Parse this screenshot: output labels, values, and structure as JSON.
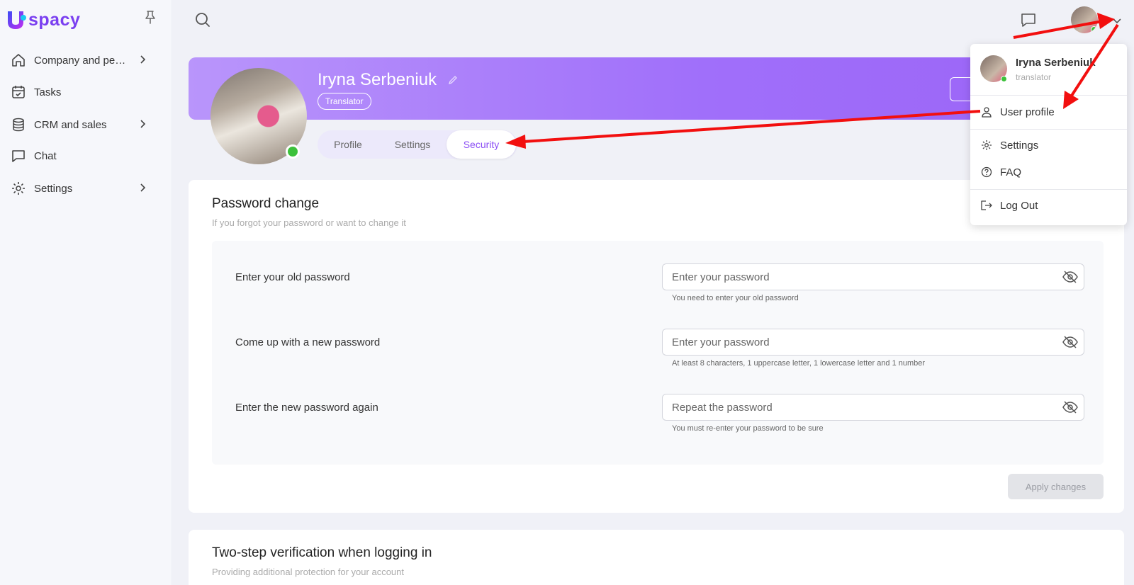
{
  "app": {
    "logo_text": "spacy"
  },
  "sidebar": {
    "items": [
      {
        "label": "Company and pe…",
        "icon": "home-icon"
      },
      {
        "label": "Tasks",
        "icon": "calendar-check-icon"
      },
      {
        "label": "CRM and sales",
        "icon": "coins-icon"
      },
      {
        "label": "Chat",
        "icon": "chat-icon"
      },
      {
        "label": "Settings",
        "icon": "gear-icon"
      }
    ]
  },
  "profile": {
    "name": "Iryna Serbeniuk",
    "role": "Translator",
    "tabs": [
      "Profile",
      "Settings",
      "Security"
    ],
    "active_tab": "Security"
  },
  "password_card": {
    "title": "Password change",
    "subtitle": "If you forgot your password or want to change it",
    "rows": [
      {
        "label": "Enter your old password",
        "placeholder": "Enter your password",
        "hint": "You need to enter your old password"
      },
      {
        "label": "Come up with a new password",
        "placeholder": "Enter your password",
        "hint": "At least 8 characters, 1 uppercase letter, 1 lowercase letter and 1 number"
      },
      {
        "label": "Enter the new password again",
        "placeholder": "Repeat the password",
        "hint": "You must re-enter your password to be sure"
      }
    ],
    "apply_label": "Apply changes"
  },
  "twostep_card": {
    "title": "Two-step verification when logging in",
    "subtitle": "Providing additional protection for your account"
  },
  "user_menu": {
    "name": "Iryna Serbeniuk",
    "role": "translator",
    "items": [
      {
        "label": "User profile",
        "icon": "user-icon"
      },
      {
        "label": "Settings",
        "icon": "gear-icon"
      },
      {
        "label": "FAQ",
        "icon": "help-circle-icon"
      },
      {
        "label": "Log Out",
        "icon": "logout-icon"
      }
    ]
  },
  "colors": {
    "accent": "#8b4ef5",
    "online": "#3cc13b",
    "annotation": "#f20f0f"
  }
}
